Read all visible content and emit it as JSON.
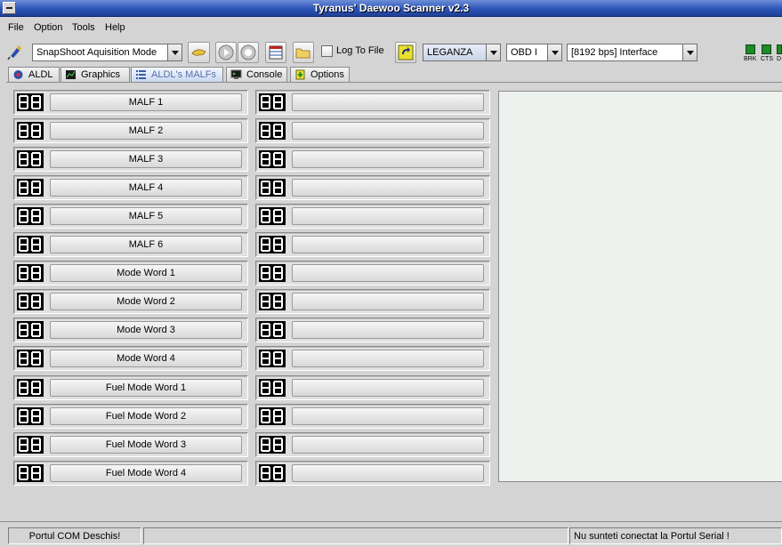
{
  "window": {
    "title": "Tyranus' Daewoo Scanner v2.3"
  },
  "menu": [
    "File",
    "Option",
    "Tools",
    "Help"
  ],
  "toolbar": {
    "mode": "SnapShoot Aquisition Mode",
    "log_to_file": "Log To File",
    "log_checked": false,
    "vehicle": "LEGANZA",
    "protocol": "OBD I",
    "interface": "[8192 bps] Interface",
    "leds": [
      "BRK",
      "CTS",
      "D"
    ],
    "led_color": "#1f8a2a"
  },
  "tabs": [
    {
      "label": "ALDL",
      "icon": "aldl-icon",
      "active": false
    },
    {
      "label": "Graphics",
      "icon": "graph-icon",
      "active": false
    },
    {
      "label": "ALDL's MALFs",
      "icon": "list-icon",
      "active": true
    },
    {
      "label": "Console",
      "icon": "console-icon",
      "active": false
    },
    {
      "label": "Options",
      "icon": "options-icon",
      "active": false
    }
  ],
  "malf_rows": [
    {
      "left": "MALF 1",
      "right": ""
    },
    {
      "left": "MALF 2",
      "right": ""
    },
    {
      "left": "MALF 3",
      "right": ""
    },
    {
      "left": "MALF 4",
      "right": ""
    },
    {
      "left": "MALF 5",
      "right": ""
    },
    {
      "left": "MALF 6",
      "right": ""
    },
    {
      "left": "Mode Word 1",
      "right": ""
    },
    {
      "left": "Mode Word 2",
      "right": ""
    },
    {
      "left": "Mode Word 3",
      "right": ""
    },
    {
      "left": "Mode Word 4",
      "right": ""
    },
    {
      "left": "Fuel Mode Word 1",
      "right": ""
    },
    {
      "left": "Fuel Mode Word 2",
      "right": ""
    },
    {
      "left": "Fuel Mode Word 3",
      "right": ""
    },
    {
      "left": "Fuel Mode Word 4",
      "right": ""
    }
  ],
  "status": {
    "port": "Portul COM Deschis!",
    "middle": "",
    "connection": "Nu sunteti conectat la Portul Serial !"
  }
}
